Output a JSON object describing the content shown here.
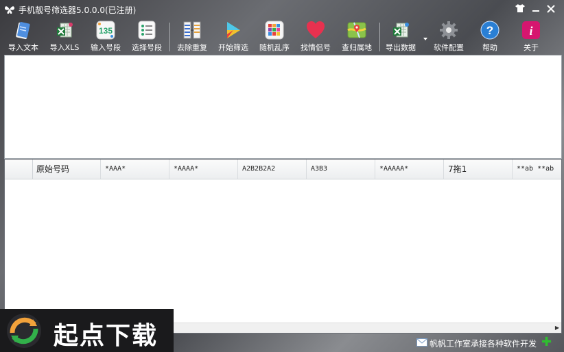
{
  "window": {
    "title": "手机靓号筛选器5.0.0.0(已注册)"
  },
  "toolbar": {
    "buttons": [
      {
        "label": "导入文本",
        "icon": "notepad-icon"
      },
      {
        "label": "导入XLS",
        "icon": "excel-import-icon"
      },
      {
        "label": "输入号段",
        "icon": "number-135-icon"
      },
      {
        "label": "选择号段",
        "icon": "list-icon"
      },
      {
        "label": "去除重复",
        "icon": "dedupe-icon"
      },
      {
        "label": "开始筛选",
        "icon": "play-icon"
      },
      {
        "label": "随机乱序",
        "icon": "shuffle-grid-icon"
      },
      {
        "label": "找情侣号",
        "icon": "heart-icon"
      },
      {
        "label": "查归属地",
        "icon": "map-icon"
      },
      {
        "label": "导出数据",
        "icon": "excel-export-icon"
      },
      {
        "label": "软件配置",
        "icon": "gear-icon"
      },
      {
        "label": "帮助",
        "icon": "help-icon"
      },
      {
        "label": "关于",
        "icon": "info-icon"
      }
    ]
  },
  "grid": {
    "columns": [
      "原始号码",
      "*AAA*",
      "*AAAA*",
      "A2B2B2A2",
      "A3B3",
      "*AAAAA*",
      "7拖1",
      "**ab **ab"
    ]
  },
  "status": {
    "text": "帆帆工作室承接各种软件开发"
  },
  "watermark": {
    "text": "起点下载"
  },
  "colors": {
    "accent_red": "#e8314f",
    "help_blue": "#2a7fd4",
    "info_pink": "#d6166f",
    "plus_green": "#2fbf2f"
  }
}
